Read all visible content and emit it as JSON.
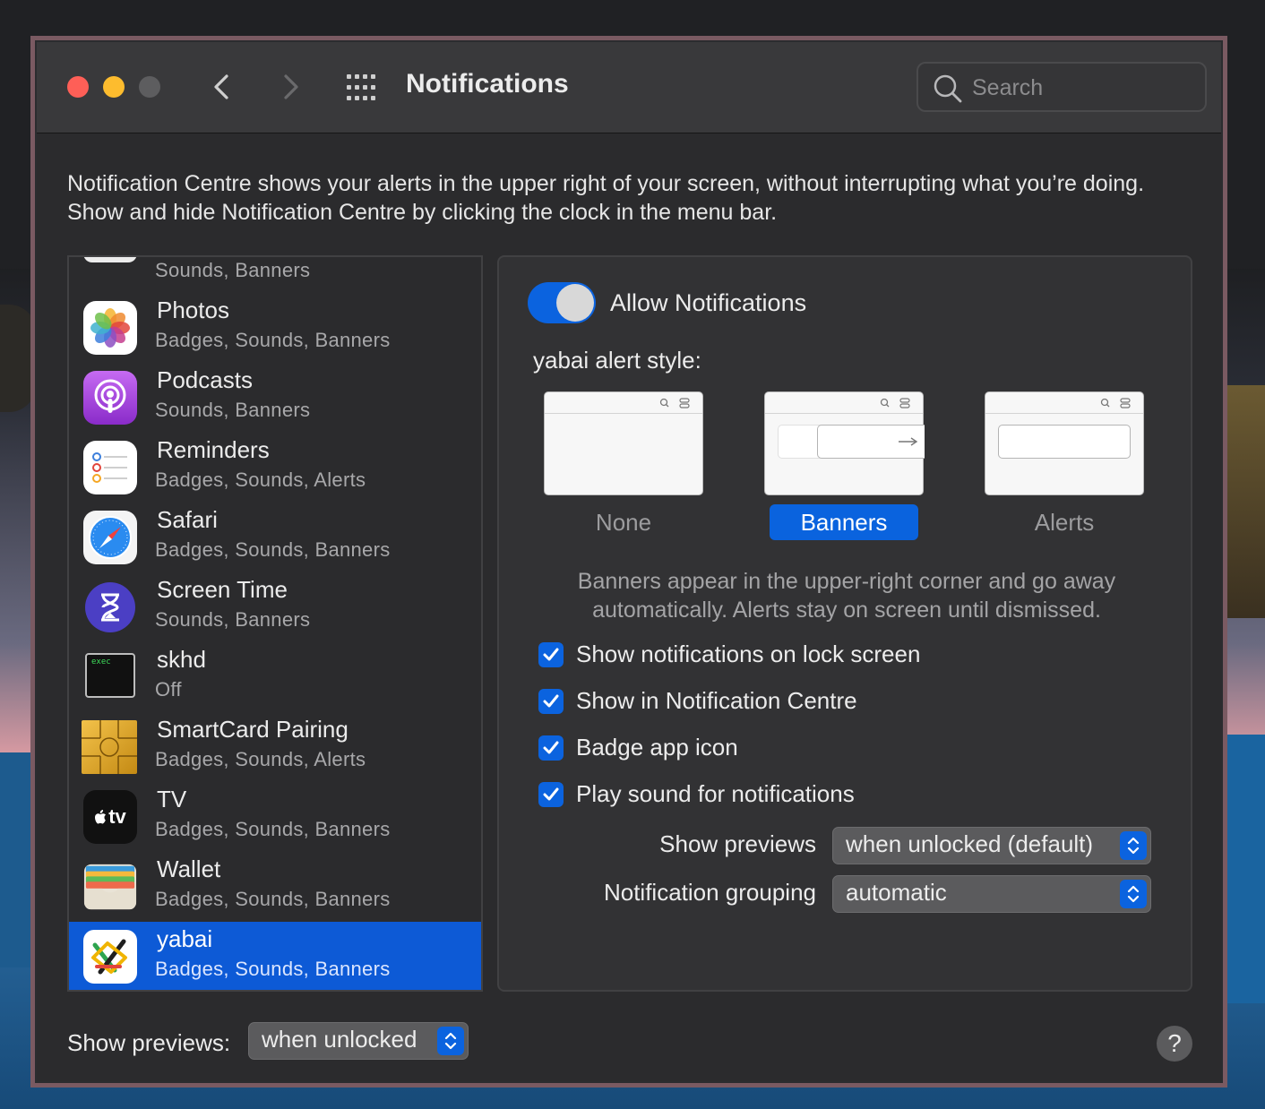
{
  "window": {
    "title": "Notifications",
    "search_placeholder": "Search"
  },
  "description": "Notification Centre shows your alerts in the upper right of your screen, without interrupting what you’re doing. Show and hide Notification Centre by clicking the clock in the menu bar.",
  "apps": [
    {
      "name": "",
      "sub": "Sounds, Banners",
      "icon": "app-icon-partial"
    },
    {
      "name": "Photos",
      "sub": "Badges, Sounds, Banners",
      "icon": "photos-icon"
    },
    {
      "name": "Podcasts",
      "sub": "Sounds, Banners",
      "icon": "podcasts-icon"
    },
    {
      "name": "Reminders",
      "sub": "Badges, Sounds, Alerts",
      "icon": "reminders-icon"
    },
    {
      "name": "Safari",
      "sub": "Badges, Sounds, Banners",
      "icon": "safari-icon"
    },
    {
      "name": "Screen Time",
      "sub": "Sounds, Banners",
      "icon": "screen-time-icon"
    },
    {
      "name": "skhd",
      "sub": "Off",
      "icon": "terminal-icon",
      "icon_text": "exec"
    },
    {
      "name": "SmartCard Pairing",
      "sub": "Badges, Sounds, Alerts",
      "icon": "smartcard-chip-icon"
    },
    {
      "name": "TV",
      "sub": "Badges, Sounds, Banners",
      "icon": "apple-tv-icon",
      "icon_text": "tv"
    },
    {
      "name": "Wallet",
      "sub": "Badges, Sounds, Banners",
      "icon": "wallet-icon"
    },
    {
      "name": "yabai",
      "sub": "Badges, Sounds, Banners",
      "icon": "yabai-icon",
      "selected": true
    }
  ],
  "detail": {
    "allow_label": "Allow Notifications",
    "allow_on": true,
    "style_label": "yabai alert style:",
    "styles": [
      {
        "name": "None",
        "active": false
      },
      {
        "name": "Banners",
        "active": true
      },
      {
        "name": "Alerts",
        "active": false
      }
    ],
    "explain": "Banners appear in the upper-right corner and go away automatically. Alerts stay on screen until dismissed.",
    "checkboxes": [
      {
        "label": "Show notifications on lock screen",
        "checked": true
      },
      {
        "label": "Show in Notification Centre",
        "checked": true
      },
      {
        "label": "Badge app icon",
        "checked": true
      },
      {
        "label": "Play sound for notifications",
        "checked": true
      }
    ],
    "show_previews_label": "Show previews",
    "show_previews_value": "when unlocked (default)",
    "grouping_label": "Notification grouping",
    "grouping_value": "automatic"
  },
  "footer": {
    "show_previews_label": "Show previews:",
    "show_previews_value": "when unlocked"
  },
  "help_label": "?",
  "colors": {
    "accent": "#0b63df",
    "close": "#fe5f57",
    "minimize": "#fdbc2e",
    "selection": "#0d5ad6"
  }
}
